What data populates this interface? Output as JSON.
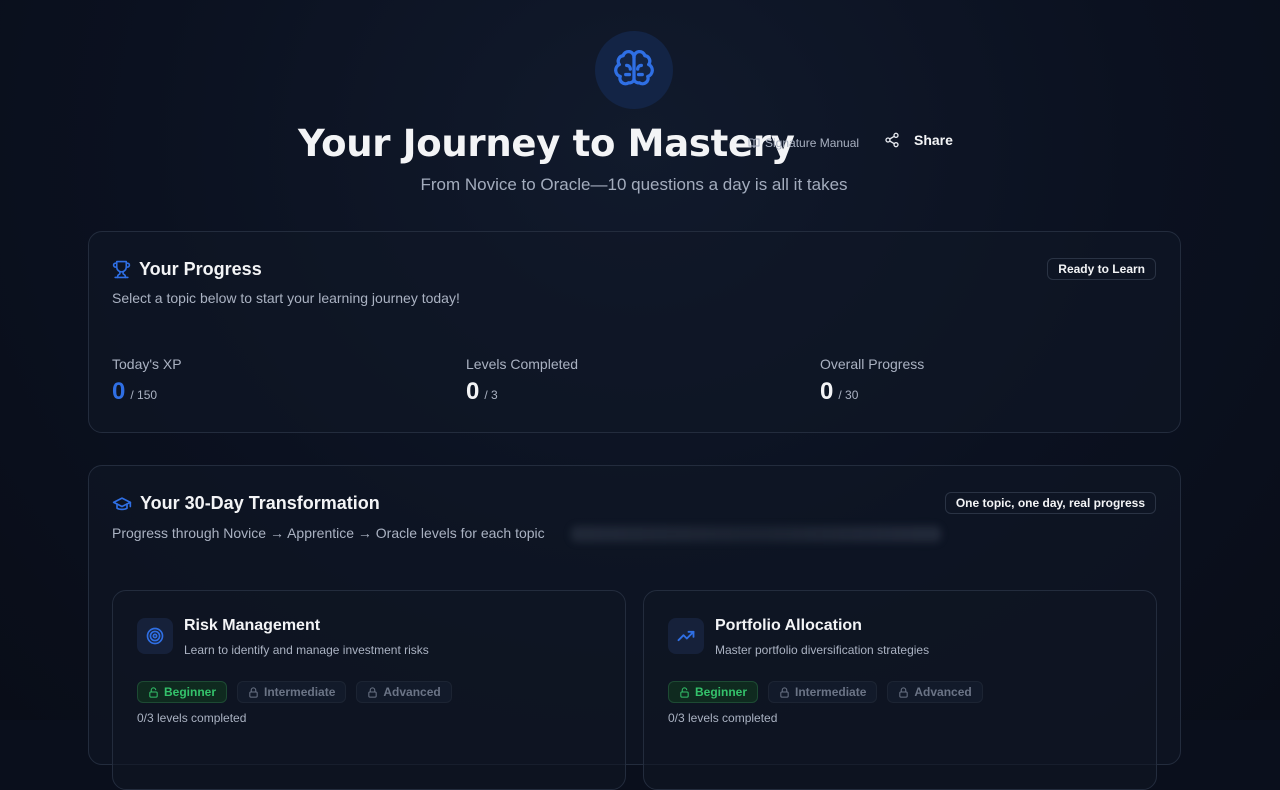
{
  "header": {
    "title": "Your Journey to Mastery",
    "manual_label": "Signature Manual",
    "share_label": "Share",
    "subtitle": "From Novice to Oracle—10 questions a day is all it takes"
  },
  "progress": {
    "title": "Your Progress",
    "description": "Select a topic below to start your learning journey today!",
    "badge": "Ready to Learn",
    "stats": [
      {
        "label": "Today's XP",
        "value": "0",
        "total": "/ 150"
      },
      {
        "label": "Levels Completed",
        "value": "0",
        "total": "/ 3"
      },
      {
        "label": "Overall Progress",
        "value": "0",
        "total": "/ 30"
      }
    ]
  },
  "transformation": {
    "title": "Your 30-Day Transformation",
    "description": "Progress through Novice → Apprentice → Oracle levels for each topic",
    "badge": "One topic, one day, real progress",
    "topics": [
      {
        "title": "Risk Management",
        "description": "Learn to identify and manage investment risks",
        "icon": "target-icon",
        "levels": [
          "Beginner",
          "Intermediate",
          "Advanced"
        ],
        "count": "0/3 levels completed"
      },
      {
        "title": "Portfolio Allocation",
        "description": "Master portfolio diversification strategies",
        "icon": "trending-up-icon",
        "levels": [
          "Beginner",
          "Intermediate",
          "Advanced"
        ],
        "count": "0/3 levels completed"
      }
    ]
  },
  "colors": {
    "accent": "#2f6fe4",
    "success": "#34c26b",
    "background": "#0a0f1c"
  }
}
